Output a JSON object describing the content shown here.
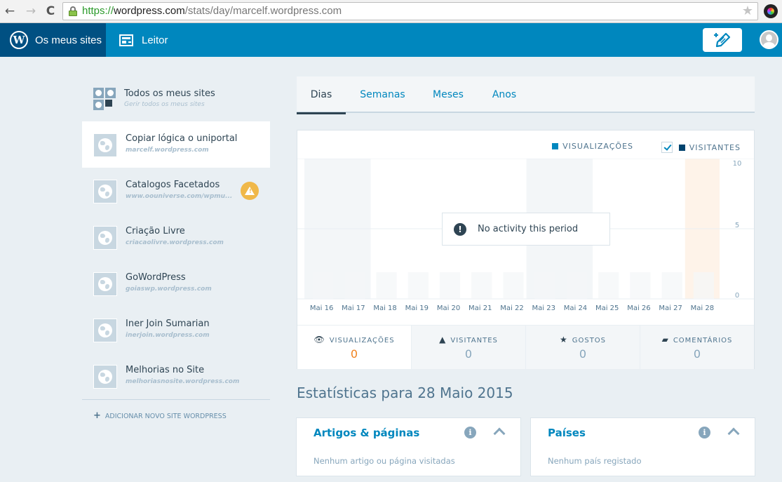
{
  "browser": {
    "url_scheme": "https://",
    "url_host": "wordpress.com",
    "url_path": "/stats/day/marcelf.wordpress.com",
    "back_icon": "←",
    "forward_icon": "→",
    "reload_icon": "C",
    "bookmark_icon": "★"
  },
  "masterbar": {
    "my_sites_label": "Os meus sites",
    "wp_logo_glyph": "W",
    "reader_label": "Leitor"
  },
  "sidebar": {
    "all_sites": {
      "name": "Todos os meus sites",
      "subtitle": "Gerir todos os meus sites"
    },
    "sites": [
      {
        "name": "Copiar lógica o uniportal",
        "url": "marcelf.wordpress.com",
        "selected": true
      },
      {
        "name": "Catalogos Facetados",
        "url": "www.oouniverse.com/wpmu...",
        "warning": true
      },
      {
        "name": "Criação Livre",
        "url": "criacaolivre.wordpress.com"
      },
      {
        "name": "GoWordPress",
        "url": "goiaswp.wordpress.com"
      },
      {
        "name": "Iner Join Sumarian",
        "url": "inerjoin.wordpress.com"
      },
      {
        "name": "Melhorias no Site",
        "url": "melhoriasnosite.wordpress.com"
      }
    ],
    "add_site_icon": "+",
    "add_site_label": "ADICIONAR NOVO SITE WORDPRESS",
    "warning_glyph": "!"
  },
  "period_tabs": [
    {
      "label": "Dias",
      "active": true
    },
    {
      "label": "Semanas"
    },
    {
      "label": "Meses"
    },
    {
      "label": "Anos"
    }
  ],
  "chart": {
    "legend_views": "VISUALIZAÇÕES",
    "legend_visitors": "VISITANTES",
    "visitors_checked": true,
    "no_activity_icon": "!",
    "no_activity_message": "No activity this period",
    "colors": {
      "views": "#0087be",
      "visitors": "#00436e",
      "weekend": "#f3f6f8",
      "selected_day": "#fef3e9",
      "placeholder_bar": "#f3f6f8"
    }
  },
  "chart_data": {
    "type": "bar",
    "categories": [
      "Mai 16",
      "Mai 17",
      "Mai 18",
      "Mai 19",
      "Mai 20",
      "Mai 21",
      "Mai 22",
      "Mai 23",
      "Mai 24",
      "Mai 25",
      "Mai 26",
      "Mai 27",
      "Mai 28"
    ],
    "series": [
      {
        "name": "VISUALIZAÇÕES",
        "values": [
          0,
          0,
          0,
          0,
          0,
          0,
          0,
          0,
          0,
          0,
          0,
          0,
          0
        ]
      },
      {
        "name": "VISITANTES",
        "values": [
          0,
          0,
          0,
          0,
          0,
          0,
          0,
          0,
          0,
          0,
          0,
          0,
          0
        ]
      }
    ],
    "weekend_categories": [
      "Mai 16",
      "Mai 17",
      "Mai 23",
      "Mai 24"
    ],
    "selected_category": "Mai 28",
    "yticks": [
      0,
      5,
      10
    ],
    "ylim": [
      0,
      10
    ],
    "grid": true,
    "legend": "top-right",
    "title": "",
    "xlabel": "",
    "ylabel": ""
  },
  "stat_tabs": [
    {
      "label": "VISUALIZAÇÕES",
      "icon": "👁",
      "value": "0",
      "active": true
    },
    {
      "label": "VISITANTES",
      "icon": "▲",
      "value": "0"
    },
    {
      "label": "GOSTOS",
      "icon": "★",
      "value": "0"
    },
    {
      "label": "COMENTÁRIOS",
      "icon": "▰",
      "value": "0"
    }
  ],
  "section_title": "Estatísticas para 28 Maio 2015",
  "modules": [
    {
      "title": "Artigos & páginas",
      "empty": "Nenhum artigo ou página visitadas",
      "info_glyph": "i"
    },
    {
      "title": "Países",
      "empty": "Nenhum país registado",
      "info_glyph": "i"
    }
  ]
}
